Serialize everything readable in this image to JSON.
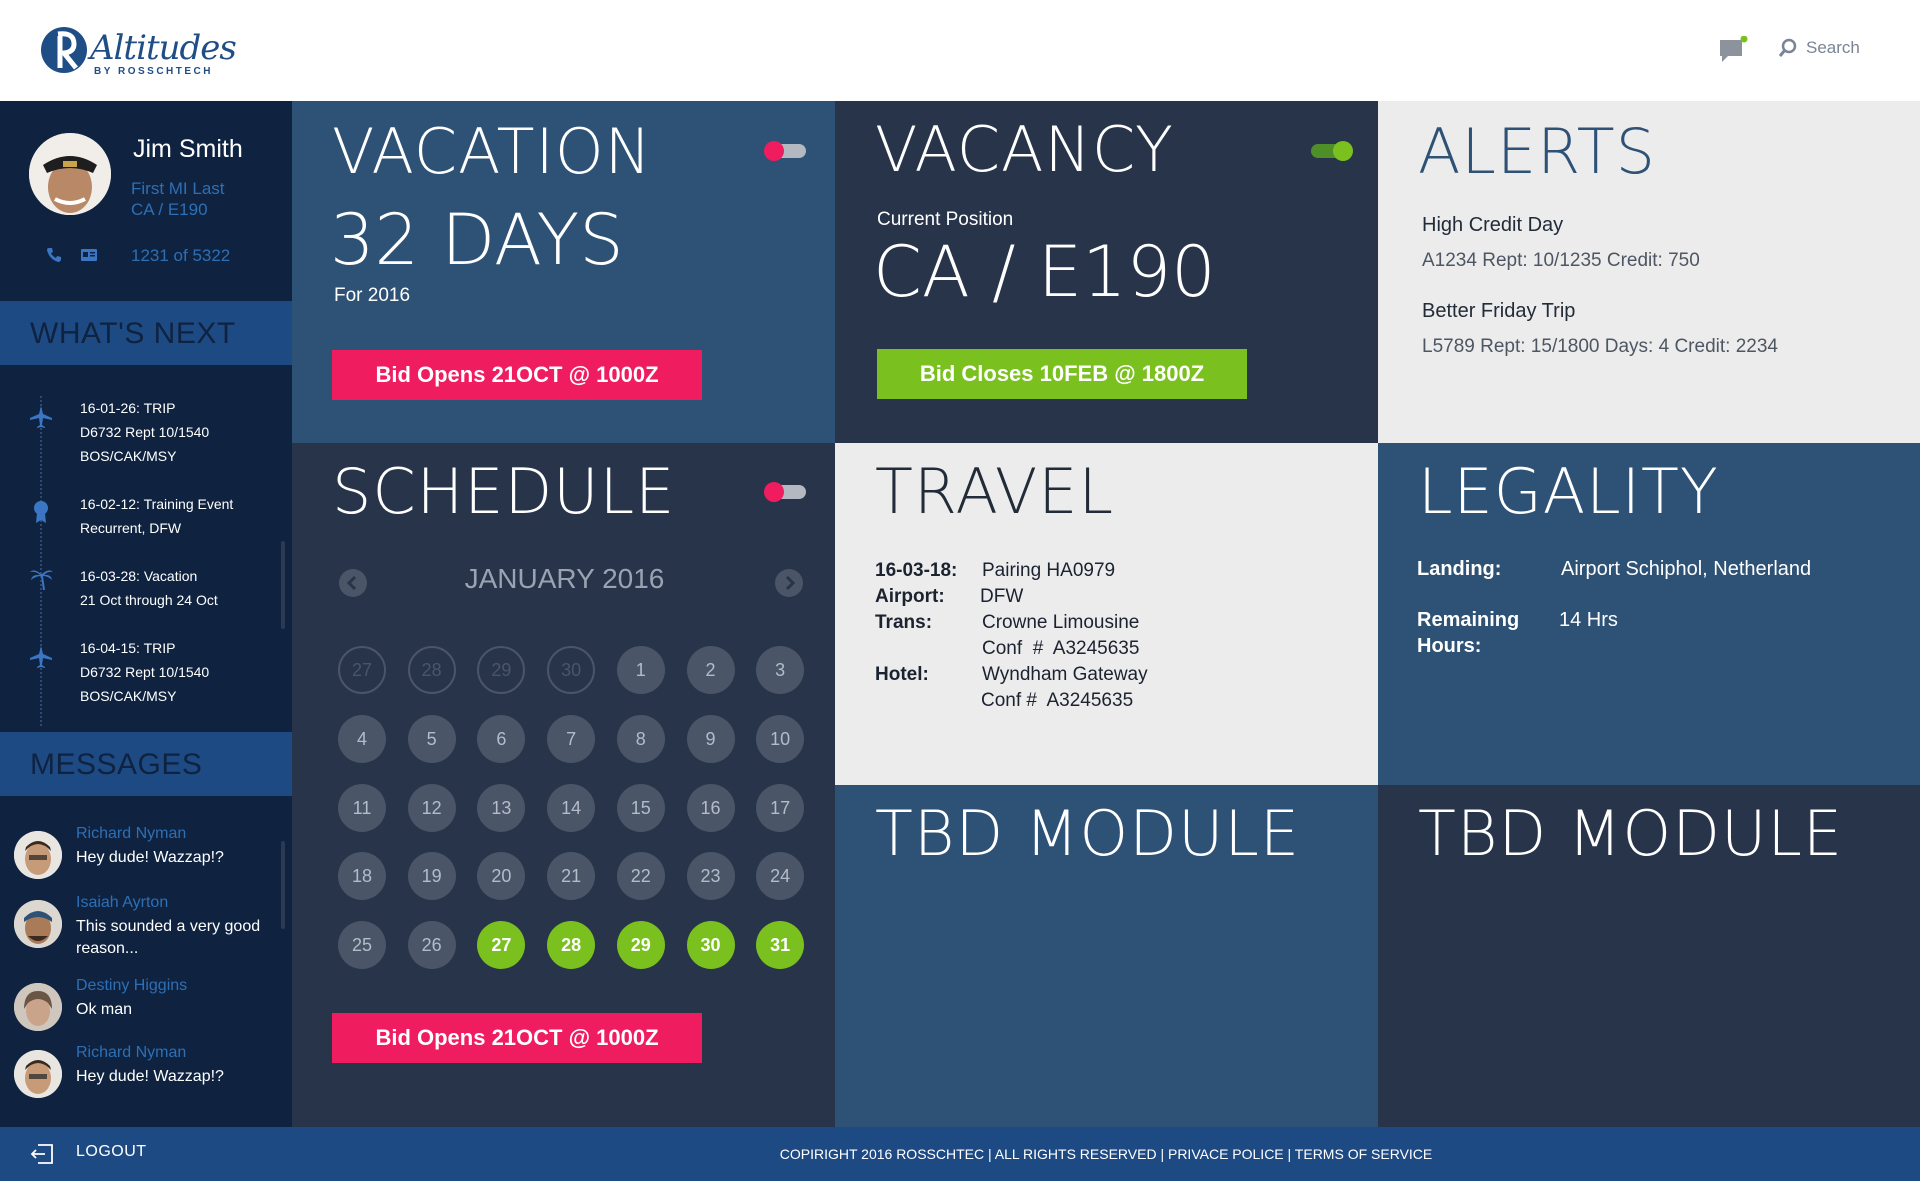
{
  "app": {
    "logo_text": "Altitudes",
    "logo_sub": "BY ROSSCHTECH"
  },
  "header": {
    "search_label": "Search"
  },
  "profile": {
    "name": "Jim  Smith",
    "line1": "First MI Last",
    "line2": "CA / E190",
    "seniority": "1231 of 5322"
  },
  "whats_next": {
    "title": "WHAT'S NEXT",
    "items": [
      {
        "line1": "16-01-26: TRIP",
        "line2": "D6732 Rept 10/1540",
        "line3": "BOS/CAK/MSY",
        "icon": "plane-icon"
      },
      {
        "line1": "16-02-12:  Training Event",
        "line2": "Recurrent, DFW",
        "line3": "",
        "icon": "award-icon"
      },
      {
        "line1": "16-03-28:  Vacation",
        "line2": "21 Oct through 24 Oct",
        "line3": "",
        "icon": "palm-tree-icon"
      },
      {
        "line1": "16-04-15: TRIP",
        "line2": "D6732 Rept 10/1540",
        "line3": "BOS/CAK/MSY",
        "icon": "plane-icon"
      }
    ]
  },
  "messages": {
    "title": "MESSAGES",
    "items": [
      {
        "name": "Richard Nyman",
        "text": "Hey dude! Wazzap!?"
      },
      {
        "name": "Isaiah Ayrton",
        "text": "This sounded a very good reason..."
      },
      {
        "name": "Destiny Higgins",
        "text": "Ok man"
      },
      {
        "name": "Richard Nyman",
        "text": "Hey dude! Wazzap!?"
      }
    ]
  },
  "logout_label": "LOGOUT",
  "vacation": {
    "title": "VACATION",
    "days": "32 DAYS",
    "year": "For 2016",
    "button": "Bid Opens 21OCT @ 1000Z",
    "toggle_on": false
  },
  "vacancy": {
    "title": "VACANCY",
    "label": "Current Position",
    "position": "CA / E190",
    "button": "Bid Closes 10FEB @ 1800Z",
    "toggle_on": true
  },
  "alerts": {
    "title": "ALERTS",
    "items": [
      {
        "title": "High Credit Day",
        "detail": "A1234  Rept: 10/1235 Credit: 750"
      },
      {
        "title": "Better Friday Trip",
        "detail": "L5789 Rept: 15/1800 Days: 4 Credit: 2234"
      }
    ]
  },
  "schedule": {
    "title": "SCHEDULE",
    "month": "JANUARY 2016",
    "button": "Bid Opens 21OCT @ 1000Z",
    "toggle_on": false,
    "days": [
      {
        "n": "27",
        "kind": "outside"
      },
      {
        "n": "28",
        "kind": "outside"
      },
      {
        "n": "29",
        "kind": "outside"
      },
      {
        "n": "30",
        "kind": "outside"
      },
      {
        "n": "1",
        "kind": "normal"
      },
      {
        "n": "2",
        "kind": "normal"
      },
      {
        "n": "3",
        "kind": "normal"
      },
      {
        "n": "4",
        "kind": "normal"
      },
      {
        "n": "5",
        "kind": "normal"
      },
      {
        "n": "6",
        "kind": "normal"
      },
      {
        "n": "7",
        "kind": "normal"
      },
      {
        "n": "8",
        "kind": "normal"
      },
      {
        "n": "9",
        "kind": "normal"
      },
      {
        "n": "10",
        "kind": "normal"
      },
      {
        "n": "11",
        "kind": "normal"
      },
      {
        "n": "12",
        "kind": "normal"
      },
      {
        "n": "13",
        "kind": "normal"
      },
      {
        "n": "14",
        "kind": "normal"
      },
      {
        "n": "15",
        "kind": "normal"
      },
      {
        "n": "16",
        "kind": "normal"
      },
      {
        "n": "17",
        "kind": "normal"
      },
      {
        "n": "18",
        "kind": "normal"
      },
      {
        "n": "19",
        "kind": "normal"
      },
      {
        "n": "20",
        "kind": "normal"
      },
      {
        "n": "21",
        "kind": "normal"
      },
      {
        "n": "22",
        "kind": "normal"
      },
      {
        "n": "23",
        "kind": "normal"
      },
      {
        "n": "24",
        "kind": "normal"
      },
      {
        "n": "25",
        "kind": "normal"
      },
      {
        "n": "26",
        "kind": "normal"
      },
      {
        "n": "27",
        "kind": "selected"
      },
      {
        "n": "28",
        "kind": "selected"
      },
      {
        "n": "29",
        "kind": "selected"
      },
      {
        "n": "30",
        "kind": "selected"
      },
      {
        "n": "31",
        "kind": "selected"
      }
    ]
  },
  "travel": {
    "title": "TRAVEL",
    "date_label": "16-03-18:",
    "date_value": "Pairing HA0979",
    "airport_label": "Airport:",
    "airport_value": "DFW",
    "trans_label": "Trans:",
    "trans_value": "Crowne Limousine",
    "trans_conf": "Conf  #  A3245635",
    "hotel_label": "Hotel:",
    "hotel_value": "Wyndham Gateway",
    "hotel_conf": "Conf #  A3245635"
  },
  "legality": {
    "title": "LEGALITY",
    "landing_label": "Landing:",
    "landing_value": "Airport Schiphol, Netherland",
    "remaining_label_1": "Remaining",
    "remaining_label_2": "Hours:",
    "remaining_value": "14 Hrs"
  },
  "tbd1": {
    "title": "TBD MODULE"
  },
  "tbd2": {
    "title": "TBD MODULE"
  },
  "footer": {
    "text": "COPIRIGHT 2016 ROSSCHTEC | ALL RIGHTS RESERVED | PRIVACE POLICE  | TERMS OF SERVICE"
  },
  "colors": {
    "navy": "#0f2340",
    "tile_blue": "#2e5176",
    "tile_dark": "#283449",
    "tile_light": "#ececec",
    "accent_blue": "#1e4a84",
    "pink": "#ef1c5f",
    "green": "#7ac11f"
  }
}
